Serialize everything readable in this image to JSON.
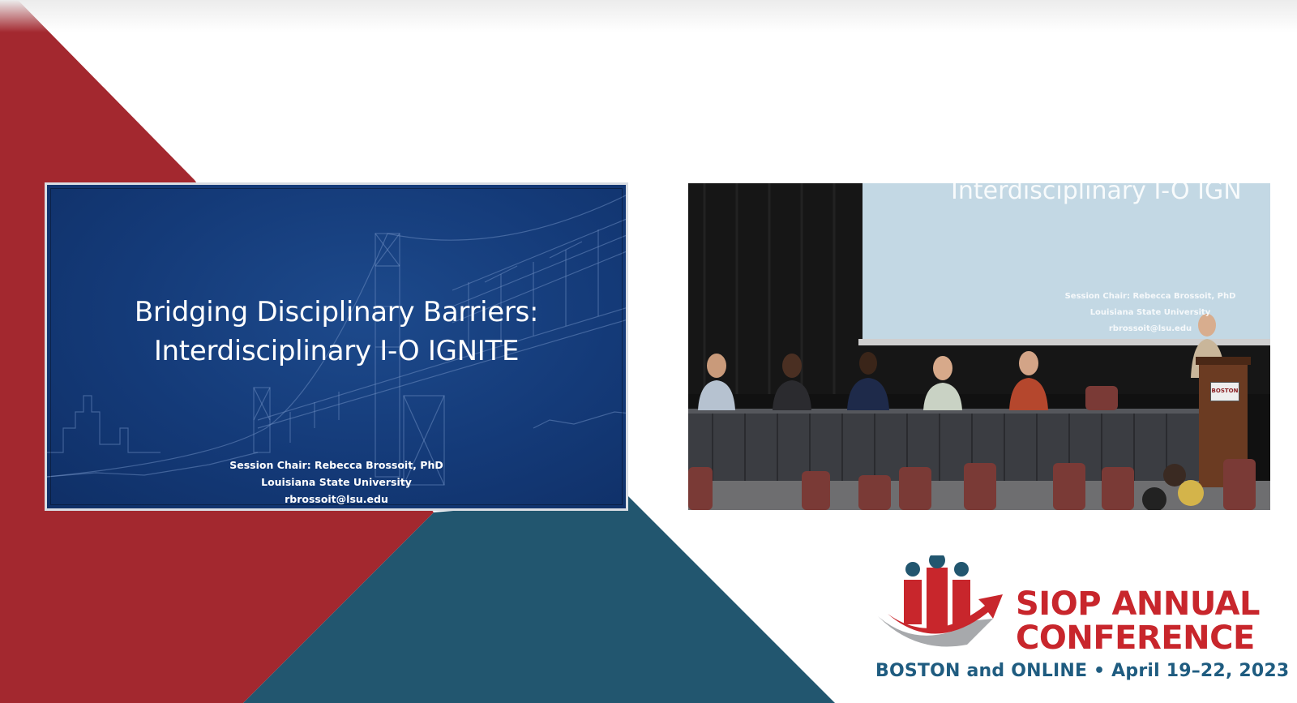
{
  "slide": {
    "title_line1": "Bridging Disciplinary Barriers:",
    "title_line2": "Interdisciplinary I-O IGNITE",
    "chair": "Session Chair: Rebecca Brossoit, PhD",
    "university": "Louisiana State University",
    "email": "rbrossoit@lsu.edu"
  },
  "video": {
    "screen_title": "Interdisciplinary I-O IGN",
    "screen_chair": "Session Chair: Rebecca Brossoit, PhD",
    "screen_university": "Louisiana State University",
    "screen_email": "rbrossoit@lsu.edu",
    "podium_sign": "BOSTON"
  },
  "logo": {
    "line1": "SIOP ANNUAL",
    "line2": "CONFERENCE",
    "subline": "BOSTON and ONLINE • April 19–22, 2023"
  },
  "colors": {
    "brand_red": "#a3282f",
    "brand_teal": "#22566f",
    "slide_blue": "#143a78"
  }
}
